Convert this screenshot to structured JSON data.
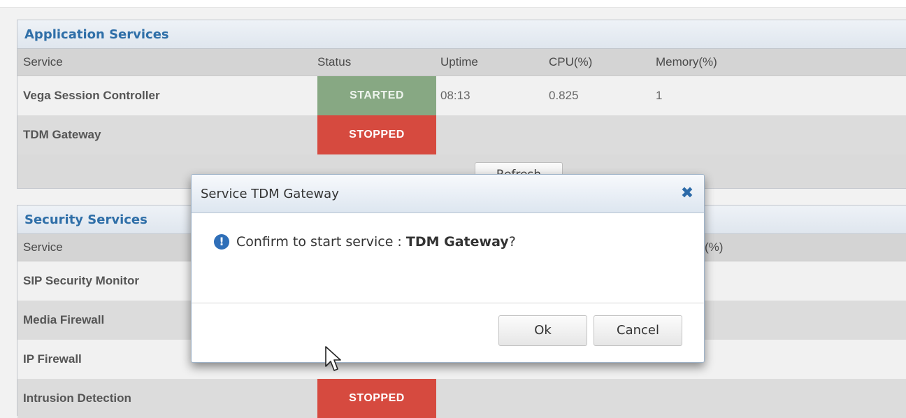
{
  "app_services": {
    "title": "Application Services",
    "headers": {
      "service": "Service",
      "status": "Status",
      "uptime": "Uptime",
      "cpu": "CPU(%)",
      "memory": "Memory(%)"
    },
    "rows": [
      {
        "service": "Vega Session Controller",
        "status": "STARTED",
        "uptime": "08:13",
        "cpu": "0.825",
        "memory": "1"
      },
      {
        "service": "TDM Gateway",
        "status": "STOPPED",
        "uptime": "",
        "cpu": "",
        "memory": ""
      }
    ],
    "refresh_label": "Refresh"
  },
  "security_services": {
    "title": "Security Services",
    "headers": {
      "service": "Service",
      "memory_partial": "(%)"
    },
    "rows": [
      {
        "service": "SIP Security Monitor"
      },
      {
        "service": "Media Firewall"
      },
      {
        "service": "IP Firewall"
      },
      {
        "service": "Intrusion Detection",
        "status": "STOPPED"
      }
    ]
  },
  "dialog": {
    "title": "Service TDM Gateway",
    "message_prefix": "Confirm to start service : ",
    "message_service": "TDM Gateway",
    "message_suffix": "?",
    "ok_label": "Ok",
    "cancel_label": "Cancel",
    "close_icon": "close-icon",
    "info_icon": "info-icon",
    "info_glyph": "!"
  },
  "colors": {
    "started": "#87a883",
    "stopped": "#d64a3f",
    "title_text": "#2f6fa8"
  }
}
